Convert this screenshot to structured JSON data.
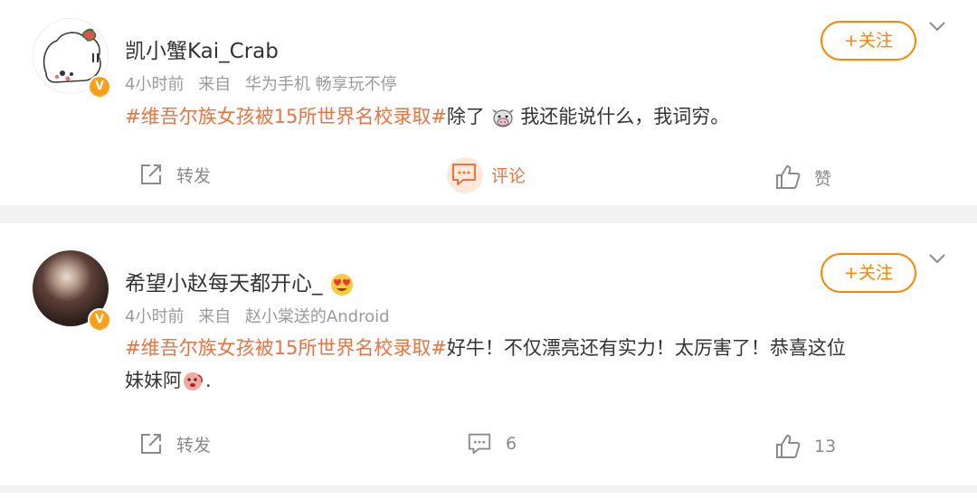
{
  "posts": [
    {
      "username": "凯小蟹Kai_Crab",
      "meta": {
        "time": "4小时前",
        "from_prefix": "来自",
        "source": "华为手机 畅享玩不停"
      },
      "hashtag": "#维吾尔族女孩被15所世界名校录取#",
      "text_before_emoji": "除了",
      "text_after_emoji": "我还能说什么，我词穷。",
      "follow_label": "+关注",
      "actions": {
        "repost": "转发",
        "comment": "评论",
        "like": "赞"
      }
    },
    {
      "username": "希望小赵每天都开心_",
      "meta": {
        "time": "4小时前",
        "from_prefix": "来自",
        "source": "赵小棠送的Android"
      },
      "hashtag": "#维吾尔族女孩被15所世界名校录取#",
      "text_line1": "好牛！不仅漂亮还有实力！太厉害了！恭喜这位",
      "text_line2_before_emoji": "妹妹阿",
      "text_line2_after_emoji": ".",
      "follow_label": "+关注",
      "actions": {
        "repost": "转发",
        "comment": "6",
        "like": "13"
      }
    }
  ],
  "colors": {
    "hashtag": "#eb7340",
    "follow": "#ff8200",
    "verified_badge": "#ff9f1a",
    "muted_text": "#9a9a9a"
  },
  "icons": [
    "chevron-down-icon",
    "repost-icon",
    "comment-icon",
    "like-icon",
    "verified-badge-icon",
    "cow-emoji-icon",
    "heart-eyes-emoji-icon",
    "blush-emoji-icon"
  ]
}
